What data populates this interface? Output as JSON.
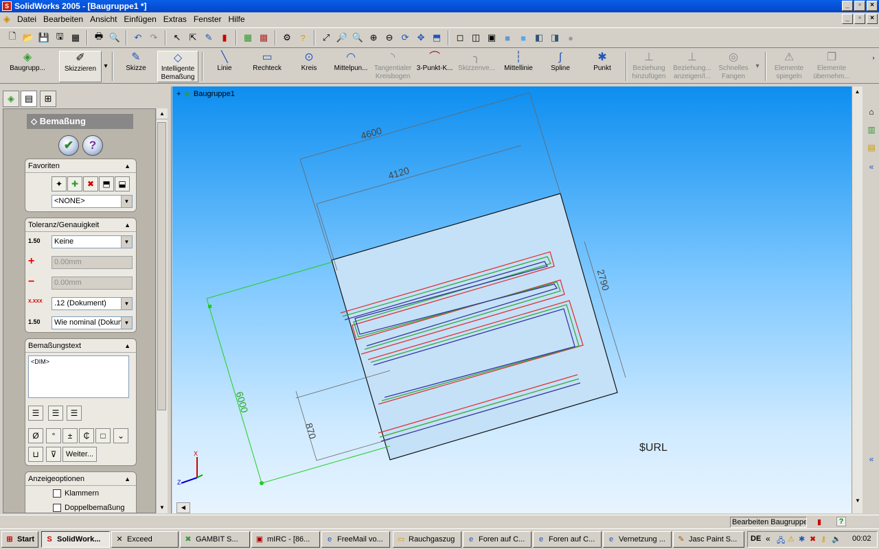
{
  "window": {
    "title": "SolidWorks 2005 - [Baugruppe1 *]"
  },
  "menu": [
    "Datei",
    "Bearbeiten",
    "Ansicht",
    "Einfügen",
    "Extras",
    "Fenster",
    "Hilfe"
  ],
  "commands": {
    "baugruppe": "Baugrupp...",
    "skizzieren": "Skizzieren",
    "skizze": "Skizze",
    "intelligente1": "Intelligente",
    "intelligente2": "Bemaßung",
    "linie": "Linie",
    "rechteck": "Rechteck",
    "kreis": "Kreis",
    "mittelpunkt": "Mittelpun...",
    "tangential1": "Tangentialer",
    "tangential2": "Kreisbogen",
    "dreipunkt": "3-Punkt-K...",
    "skizzenver": "Skizzenve...",
    "mittellinie": "Mittellinie",
    "spline": "Spline",
    "punkt": "Punkt",
    "beziehung1a": "Beziehung",
    "beziehung1b": "hinzufügen",
    "beziehung2a": "Beziehung...",
    "beziehung2b": "anzeigen/l...",
    "fangen1": "Schnelles",
    "fangen2": "Fangen",
    "spiegeln1": "Elemente",
    "spiegeln2": "spiegeln",
    "uebernehm1": "Elemente",
    "uebernehm2": "übernehm..."
  },
  "propertymanager": {
    "title": "Bemaßung",
    "ok_icon": "✔",
    "help_icon": "?",
    "favoriten": {
      "title": "Favoriten",
      "value": "<NONE>"
    },
    "toleranz": {
      "title": "Toleranz/Genauigkeit",
      "tol_type": "Keine",
      "plus": "0.00mm",
      "minus": "0.00mm",
      "precision": ".12 (Dokument)",
      "tol_precision": "Wie nominal (Dokum",
      "ico_tol": "1.50",
      "ico_prec": "X.XXX",
      "ico_tolprec": "1.50"
    },
    "bemtext": {
      "title": "Bemaßungstext",
      "value": "<DIM>",
      "weiter": "Weiter..."
    },
    "anzeige": {
      "title": "Anzeigeoptionen",
      "klammern": "Klammern",
      "doppel": "Doppelbemaßung"
    }
  },
  "tree": {
    "root": "Baugruppe1",
    "expander": "+"
  },
  "drawing": {
    "dims": [
      "4600",
      "4120",
      "2790",
      "6000",
      "870"
    ],
    "url_text": "$URL",
    "triad": {
      "x": "X",
      "z": "Z"
    }
  },
  "status": {
    "text": "Bearbeiten Baugruppe"
  },
  "taskbar": {
    "start": "Start",
    "items": [
      "SolidWork...",
      "Exceed",
      "GAMBIT    S...",
      "mIRC - [86...",
      "FreeMail vo...",
      "Rauchgaszug",
      "Foren auf C...",
      "Foren auf C...",
      "Vernetzung ...",
      "Jasc Paint S..."
    ],
    "lang": "DE",
    "clock": "00:02"
  }
}
